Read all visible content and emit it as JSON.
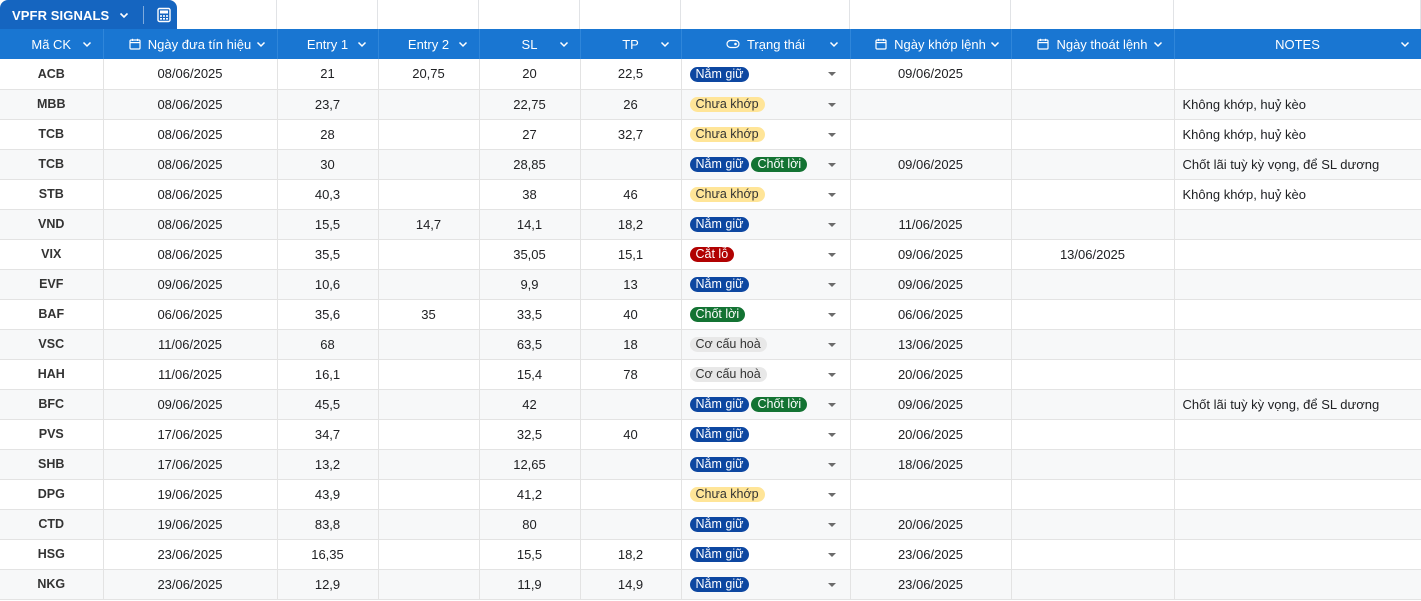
{
  "tab": {
    "title": "VPFR SIGNALS"
  },
  "headers": {
    "symbol": "Mã CK",
    "signal_date": "Ngày đưa tín hiệu",
    "entry1": "Entry 1",
    "entry2": "Entry 2",
    "sl": "SL",
    "tp": "TP",
    "status": "Trạng thái",
    "fill_date": "Ngày khớp lệnh",
    "exit_date": "Ngày thoát lệnh",
    "notes": "NOTES"
  },
  "colors": {
    "header_bg": "#1976d2",
    "tab_bg": "#1565c0",
    "hold_chip": "#0d47a1",
    "pending_chip": "#ffe598",
    "profit_chip": "#137333",
    "loss_chip": "#b10202",
    "restructure_chip": "#e8e8e8"
  },
  "rows": [
    {
      "symbol": "ACB",
      "signal_date": "08/06/2025",
      "entry1": "21",
      "entry2": "20,75",
      "sl": "20",
      "tp": "22,5",
      "status": [
        {
          "label": "Nắm giữ",
          "kind": "hold"
        }
      ],
      "fill_date": "09/06/2025",
      "exit_date": "",
      "note": ""
    },
    {
      "symbol": "MBB",
      "signal_date": "08/06/2025",
      "entry1": "23,7",
      "entry2": "",
      "sl": "22,75",
      "tp": "26",
      "status": [
        {
          "label": "Chưa khớp",
          "kind": "pending"
        }
      ],
      "fill_date": "",
      "exit_date": "",
      "note": "Không khớp, huỷ kèo"
    },
    {
      "symbol": "TCB",
      "signal_date": "08/06/2025",
      "entry1": "28",
      "entry2": "",
      "sl": "27",
      "tp": "32,7",
      "status": [
        {
          "label": "Chưa khớp",
          "kind": "pending"
        }
      ],
      "fill_date": "",
      "exit_date": "",
      "note": "Không khớp, huỷ kèo"
    },
    {
      "symbol": "TCB",
      "signal_date": "08/06/2025",
      "entry1": "30",
      "entry2": "",
      "sl": "28,85",
      "tp": "",
      "status": [
        {
          "label": "Nắm giữ",
          "kind": "hold"
        },
        {
          "label": "Chốt lời",
          "kind": "profit"
        }
      ],
      "fill_date": "09/06/2025",
      "exit_date": "",
      "note": "Chốt lãi tuỳ kỳ vọng, để SL dương"
    },
    {
      "symbol": "STB",
      "signal_date": "08/06/2025",
      "entry1": "40,3",
      "entry2": "",
      "sl": "38",
      "tp": "46",
      "status": [
        {
          "label": "Chưa khớp",
          "kind": "pending"
        }
      ],
      "fill_date": "",
      "exit_date": "",
      "note": "Không khớp, huỷ kèo"
    },
    {
      "symbol": "VND",
      "signal_date": "08/06/2025",
      "entry1": "15,5",
      "entry2": "14,7",
      "sl": "14,1",
      "tp": "18,2",
      "status": [
        {
          "label": "Nắm giữ",
          "kind": "hold"
        }
      ],
      "fill_date": "11/06/2025",
      "exit_date": "",
      "note": ""
    },
    {
      "symbol": "VIX",
      "signal_date": "08/06/2025",
      "entry1": "35,5",
      "entry2": "",
      "sl": "35,05",
      "tp": "15,1",
      "status": [
        {
          "label": "Cắt lỗ",
          "kind": "loss"
        }
      ],
      "fill_date": "09/06/2025",
      "exit_date": "13/06/2025",
      "note": ""
    },
    {
      "symbol": "EVF",
      "signal_date": "09/06/2025",
      "entry1": "10,6",
      "entry2": "",
      "sl": "9,9",
      "tp": "13",
      "status": [
        {
          "label": "Nắm giữ",
          "kind": "hold"
        }
      ],
      "fill_date": "09/06/2025",
      "exit_date": "",
      "note": ""
    },
    {
      "symbol": "BAF",
      "signal_date": "06/06/2025",
      "entry1": "35,6",
      "entry2": "35",
      "sl": "33,5",
      "tp": "40",
      "status": [
        {
          "label": "Chốt lời",
          "kind": "profit"
        }
      ],
      "fill_date": "06/06/2025",
      "exit_date": "",
      "note": ""
    },
    {
      "symbol": "VSC",
      "signal_date": "11/06/2025",
      "entry1": "68",
      "entry2": "",
      "sl": "63,5",
      "tp": "18",
      "status": [
        {
          "label": "Cơ cấu hoà",
          "kind": "restr"
        }
      ],
      "fill_date": "13/06/2025",
      "exit_date": "",
      "note": ""
    },
    {
      "symbol": "HAH",
      "signal_date": "11/06/2025",
      "entry1": "16,1",
      "entry2": "",
      "sl": "15,4",
      "tp": "78",
      "status": [
        {
          "label": "Cơ cấu hoà",
          "kind": "restr"
        }
      ],
      "fill_date": "20/06/2025",
      "exit_date": "",
      "note": ""
    },
    {
      "symbol": "BFC",
      "signal_date": "09/06/2025",
      "entry1": "45,5",
      "entry2": "",
      "sl": "42",
      "tp": "",
      "status": [
        {
          "label": "Nắm giữ",
          "kind": "hold"
        },
        {
          "label": "Chốt lời",
          "kind": "profit"
        }
      ],
      "fill_date": "09/06/2025",
      "exit_date": "",
      "note": "Chốt lãi tuỳ kỳ vọng, để SL dương"
    },
    {
      "symbol": "PVS",
      "signal_date": "17/06/2025",
      "entry1": "34,7",
      "entry2": "",
      "sl": "32,5",
      "tp": "40",
      "status": [
        {
          "label": "Nắm giữ",
          "kind": "hold"
        }
      ],
      "fill_date": "20/06/2025",
      "exit_date": "",
      "note": ""
    },
    {
      "symbol": "SHB",
      "signal_date": "17/06/2025",
      "entry1": "13,2",
      "entry2": "",
      "sl": "12,65",
      "tp": "",
      "status": [
        {
          "label": "Nắm giữ",
          "kind": "hold"
        }
      ],
      "fill_date": "18/06/2025",
      "exit_date": "",
      "note": ""
    },
    {
      "symbol": "DPG",
      "signal_date": "19/06/2025",
      "entry1": "43,9",
      "entry2": "",
      "sl": "41,2",
      "tp": "",
      "status": [
        {
          "label": "Chưa khớp",
          "kind": "pending"
        }
      ],
      "fill_date": "",
      "exit_date": "",
      "note": ""
    },
    {
      "symbol": "CTD",
      "signal_date": "19/06/2025",
      "entry1": "83,8",
      "entry2": "",
      "sl": "80",
      "tp": "",
      "status": [
        {
          "label": "Nắm giữ",
          "kind": "hold"
        }
      ],
      "fill_date": "20/06/2025",
      "exit_date": "",
      "note": ""
    },
    {
      "symbol": "HSG",
      "signal_date": "23/06/2025",
      "entry1": "16,35",
      "entry2": "",
      "sl": "15,5",
      "tp": "18,2",
      "status": [
        {
          "label": "Nắm giữ",
          "kind": "hold"
        }
      ],
      "fill_date": "23/06/2025",
      "exit_date": "",
      "note": ""
    },
    {
      "symbol": "NKG",
      "signal_date": "23/06/2025",
      "entry1": "12,9",
      "entry2": "",
      "sl": "11,9",
      "tp": "14,9",
      "status": [
        {
          "label": "Nắm giữ",
          "kind": "hold"
        }
      ],
      "fill_date": "23/06/2025",
      "exit_date": "",
      "note": ""
    }
  ]
}
